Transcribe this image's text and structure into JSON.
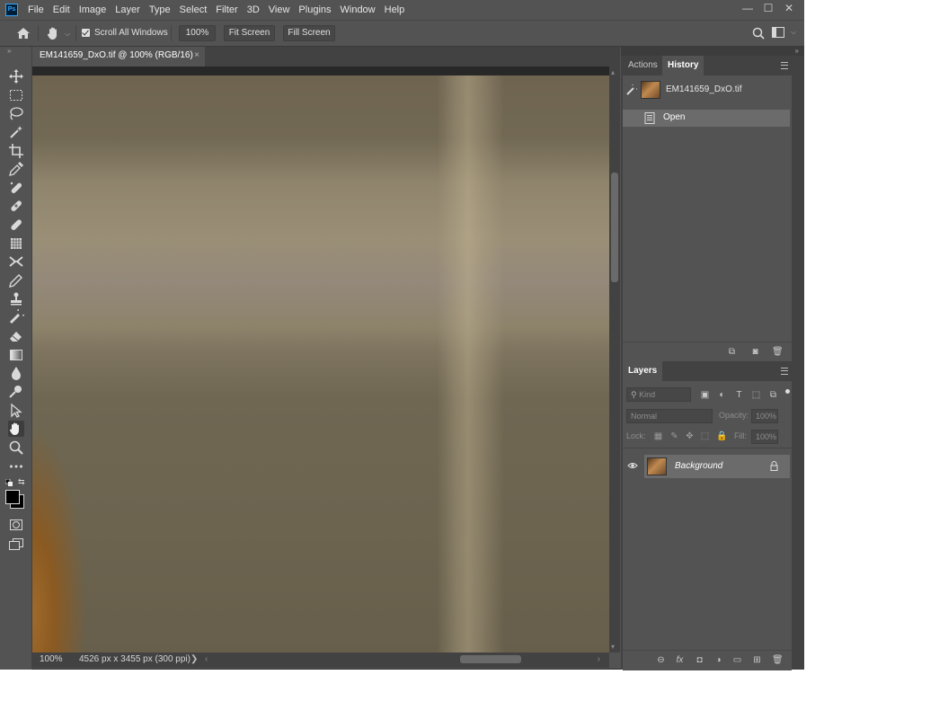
{
  "app": {
    "logo": "Ps"
  },
  "menu": [
    "File",
    "Edit",
    "Image",
    "Layer",
    "Type",
    "Select",
    "Filter",
    "3D",
    "View",
    "Plugins",
    "Window",
    "Help"
  ],
  "window_controls": {
    "minimize": "—",
    "restore": "☐",
    "close": "✕"
  },
  "options_bar": {
    "scroll_all_label": "Scroll All Windows",
    "scroll_all_checked": true,
    "zoom_value": "100%",
    "fit_screen": "Fit Screen",
    "fill_screen": "Fill Screen",
    "caret": "⌵"
  },
  "document": {
    "tab_title": "EM141659_DxO.tif @ 100% (RGB/16)",
    "tab_close": "×"
  },
  "status": {
    "zoom": "100%",
    "info": "4526 px x 3455 px (300 ppi)",
    "expand": "❯",
    "left_arrow": "‹",
    "right_arrow": "›"
  },
  "history_panel": {
    "tabs": [
      "Actions",
      "History"
    ],
    "active_tab": "History",
    "snapshot": "EM141659_DxO.tif",
    "steps": [
      "Open"
    ]
  },
  "layers_panel": {
    "title": "Layers",
    "filter_placeholder": "Kind",
    "blend_mode": "Normal",
    "opacity_label": "Opacity:",
    "opacity_value": "100%",
    "lock_label": "Lock:",
    "fill_label": "Fill:",
    "fill_value": "100%",
    "layers": [
      {
        "name": "Background",
        "visible": true,
        "locked": true
      }
    ]
  },
  "panel_collapse": "»",
  "colors": {
    "ui_bg": "#535353",
    "panel_dark": "#424242",
    "selected_row": "#6b6b6b",
    "canvas_border": "#282828"
  }
}
